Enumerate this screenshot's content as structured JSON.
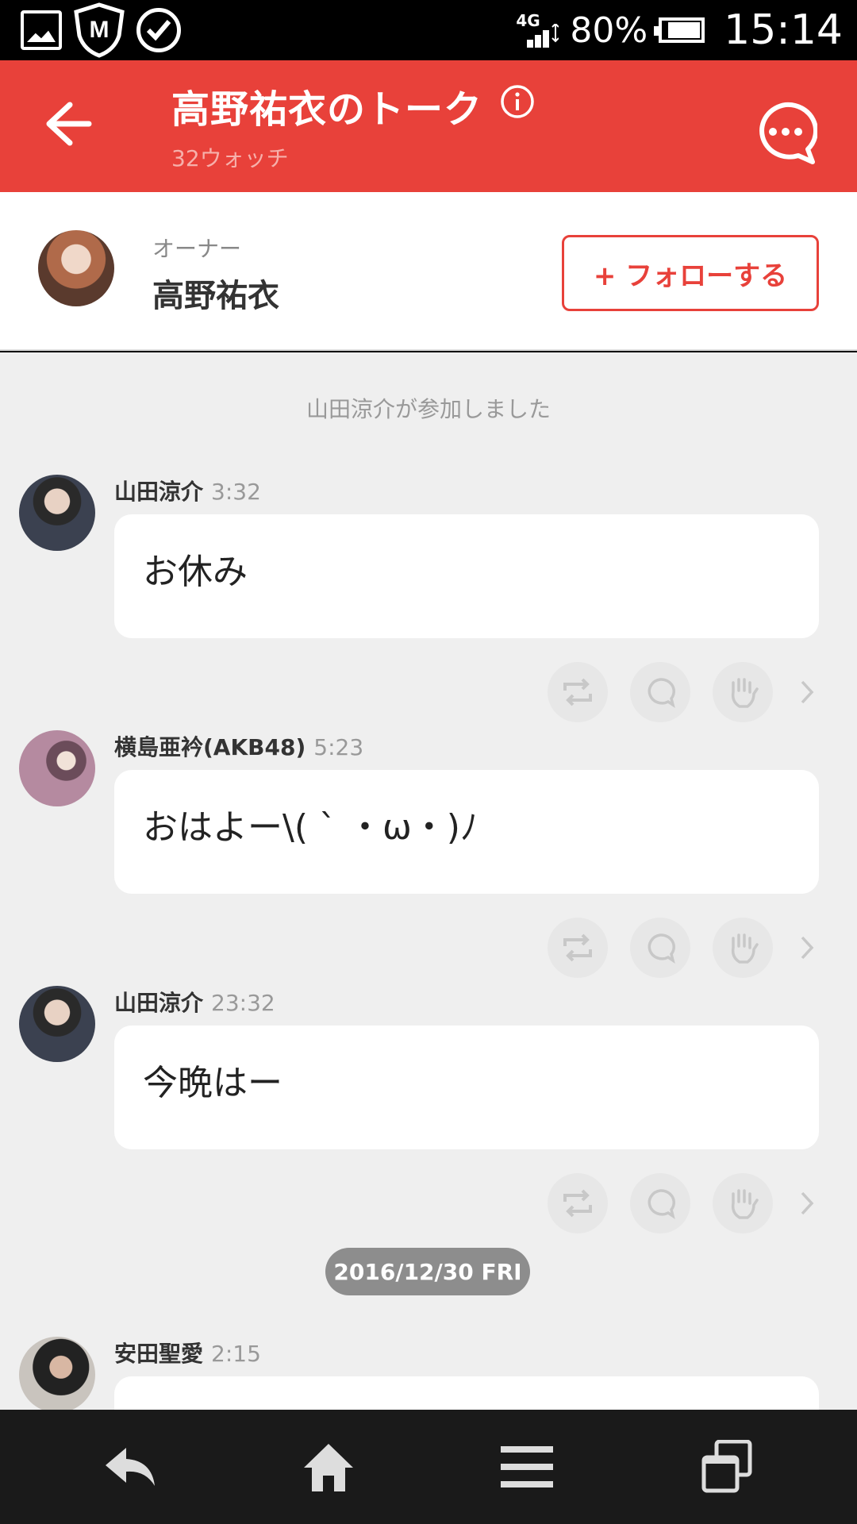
{
  "status_bar": {
    "network": "4G",
    "battery": "80%",
    "battery_level": 0.8,
    "time": "15:14",
    "icons": [
      "image-icon",
      "shield-m-icon",
      "check-circle-icon"
    ]
  },
  "header": {
    "title": "高野祐衣のトーク",
    "subtitle": "32ウォッチ",
    "accent_color": "#e8413a"
  },
  "owner": {
    "label": "オーナー",
    "name": "高野祐衣",
    "follow_label": "+ フォローする"
  },
  "feed": {
    "system_message": "山田涼介が参加しました",
    "messages": [
      {
        "name": "山田涼介",
        "time": "3:32",
        "text": "お休み"
      },
      {
        "name": "横島亜衿(AKB48)",
        "time": "5:23",
        "text": "おはよー\\( ` ・ω・)ﾉ"
      },
      {
        "name": "山田涼介",
        "time": "23:32",
        "text": "今晩はー"
      }
    ],
    "date_divider": "2016/12/30 FRI",
    "last_message": {
      "name": "安田聖愛",
      "time": "2:15"
    }
  },
  "navbar": {
    "icons": [
      "back-icon",
      "home-icon",
      "menu-icon",
      "recent-apps-icon"
    ]
  }
}
